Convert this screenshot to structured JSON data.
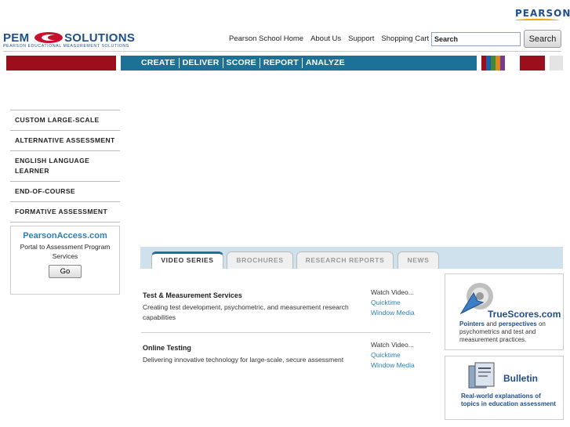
{
  "brand": {
    "pearson": "PEARSON",
    "pem_name_left": "PEM",
    "pem_name_right": "SOLUTIONS",
    "pem_tagline": "PEARSON EDUCATIONAL MEASUREMENT SOLUTIONS"
  },
  "top_nav": {
    "links": [
      "Pearson School Home",
      "About Us",
      "Support",
      "Shopping Cart"
    ],
    "search_value": "Search",
    "search_button": "Search"
  },
  "main_nav": {
    "items": [
      "CREATE",
      "DELIVER",
      "SCORE",
      "REPORT",
      "ANALYZE"
    ]
  },
  "colors": {
    "brand_red": "#9b0e1b",
    "nav_blue": "#1b7196",
    "link_blue": "#2e7fb6",
    "stripes": [
      "#9b0e1b",
      "#1f5ea8",
      "#3d8a3a",
      "#d88b1f",
      "#7a3b8c"
    ]
  },
  "left_nav": {
    "items": [
      "CUSTOM LARGE-SCALE",
      "ALTERNATIVE ASSESSMENT",
      "ENGLISH LANGUAGE LEARNER",
      "END-OF-COURSE",
      "FORMATIVE ASSESSMENT"
    ]
  },
  "access": {
    "title": "PearsonAccess.com",
    "description": "Portal to Assessment Program Services",
    "button": "Go"
  },
  "tabs": [
    "VIDEO SERIES",
    "BROCHURES",
    "RESEARCH REPORTS",
    "NEWS"
  ],
  "videos": [
    {
      "title": "Test & Measurement Services",
      "description": "Creating test development, psychometric, and measurement research capabilities",
      "watch_label": "Watch Video...",
      "link1": "Quicktime",
      "link2": "Window Media"
    },
    {
      "title": "Online Testing",
      "description": "Delivering innovative technology for large-scale, secure assessment",
      "watch_label": "Watch Video...",
      "link1": "Quicktime",
      "link2": "Window Media"
    }
  ],
  "promos": {
    "truescores": {
      "name": "TrueScores.com",
      "desc_bold1": "Pointers",
      "desc_and": " and ",
      "desc_bold2": "perspectives",
      "desc_rest": " on psychometrics and test and measurement practices."
    },
    "bulletin": {
      "name": "Bulletin",
      "desc": "Real-world explanations of topics in education assessment"
    }
  }
}
